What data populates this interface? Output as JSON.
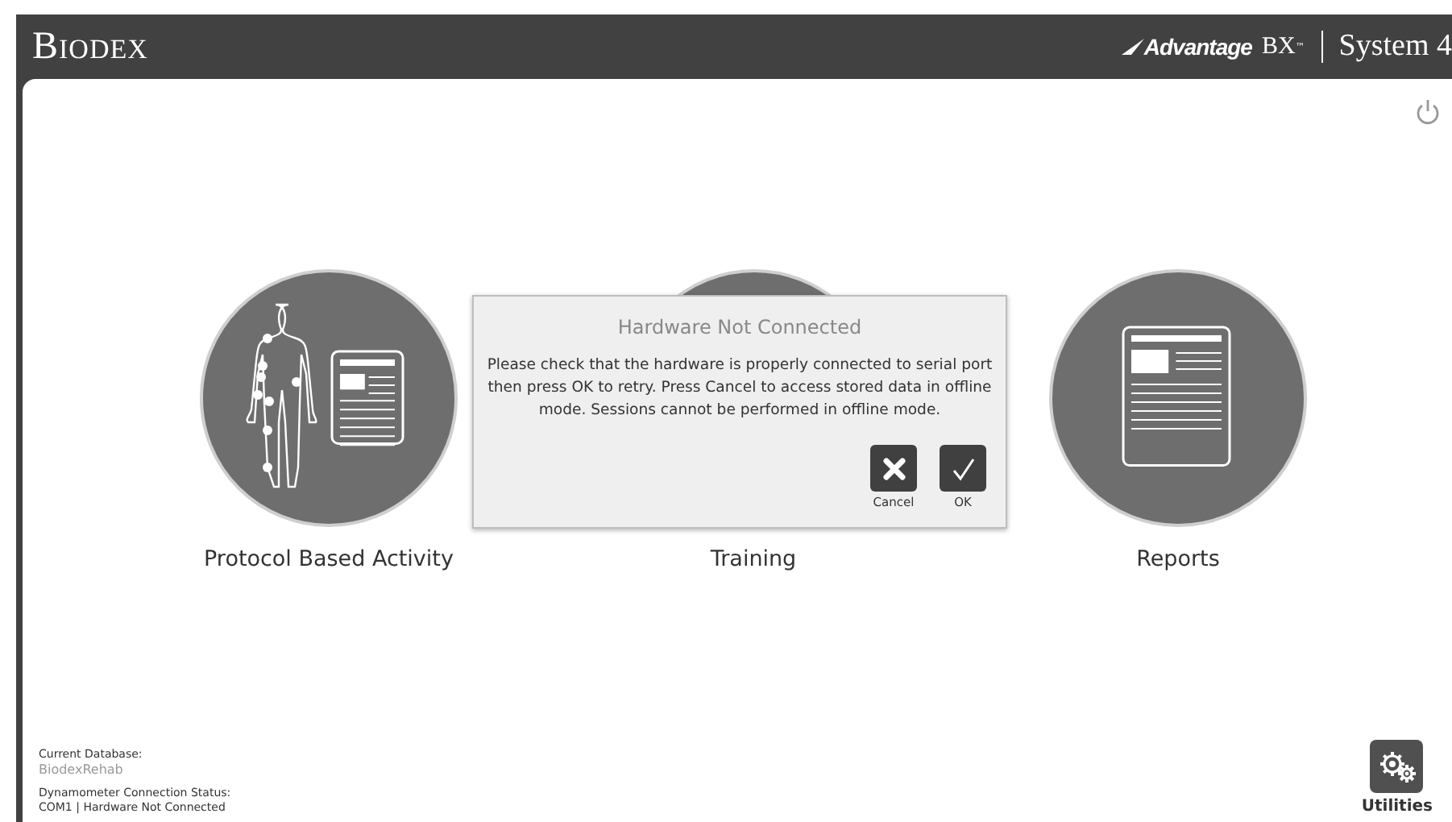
{
  "header": {
    "brand": "Biodex",
    "product": "Advantage",
    "product_suffix": "BX",
    "trademark": "™",
    "system": "System 4"
  },
  "tiles": [
    {
      "label": "Protocol Based Activity",
      "kind": "body"
    },
    {
      "label": "Training",
      "kind": "hidden"
    },
    {
      "label": "Reports",
      "kind": "report"
    }
  ],
  "dialog": {
    "title": "Hardware Not Connected",
    "message": "Please check that the hardware is properly connected to serial port then press OK to retry. Press Cancel to access stored data in offline mode. Sessions cannot be performed in offline mode.",
    "buttons": [
      {
        "label": "Cancel",
        "kind": "cancel"
      },
      {
        "label": "OK",
        "kind": "ok"
      }
    ]
  },
  "status": {
    "database_label": "Current Database:",
    "database": "BiodexRehab",
    "connection_label": "Dynamometer Connection Status:",
    "connection": "COM1 | Hardware Not Connected"
  },
  "utilities": {
    "label": "Utilities"
  }
}
